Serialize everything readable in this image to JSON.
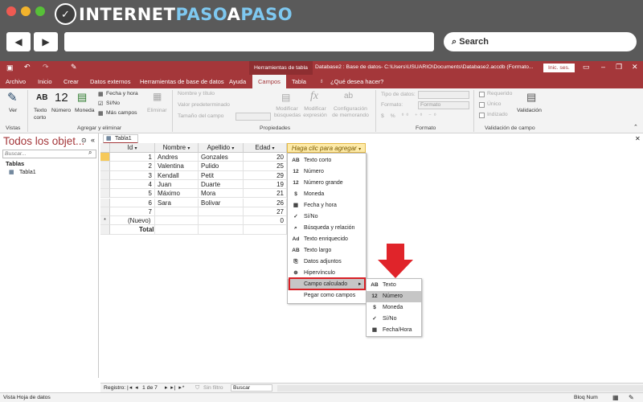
{
  "brand": {
    "logo_part1": "INTERNET",
    "logo_part2": "PASO",
    "logo_part3": "A",
    "logo_part4": "PASO",
    "accent": "#7ec8f0"
  },
  "browser": {
    "search_label": "Search",
    "back": "◀",
    "forward": "▶"
  },
  "title_bar": {
    "contextual": "Herramientas de tabla",
    "title": "Database2 : Base de datos- C:\\Users\\USUARIO\\Documents\\Database2.accdb (Formato...",
    "signin": "Inic. ses.",
    "color": "#a4373a"
  },
  "ribbon_tabs": [
    "Archivo",
    "Inicio",
    "Crear",
    "Datos externos",
    "Herramientas de base de datos",
    "Ayuda",
    "Campos",
    "Tabla"
  ],
  "tell_me": "¿Qué desea hacer?",
  "ribbon": {
    "ver": "Ver",
    "vistas": "Vistas",
    "texto_corto": "Texto corto",
    "numero": "Número",
    "moneda": "Moneda",
    "fecha_hora": "Fecha y hora",
    "si_no": "Sí/No",
    "mas_campos": "Más campos",
    "eliminar": "Eliminar",
    "agregar_eliminar": "Agregar y eliminar",
    "nombre_titulo": "Nombre y título",
    "valor_pred": "Valor predeterminado",
    "tamano": "Tamaño del campo",
    "mod_busquedas": "Modificar búsquedas",
    "mod_expresion": "Modificar expresión",
    "config_memo": "Configuración de memorando",
    "propiedades": "Propiedades",
    "tipo_datos": "Tipo de datos:",
    "formato_lbl": "Formato:",
    "formato_val": "Formato",
    "formato_grp": "Formato",
    "requerido": "Requerido",
    "unico": "Único",
    "indizado": "Indizado",
    "validacion": "Validación",
    "validacion_grp": "Validación de campo"
  },
  "nav": {
    "title": "Todos los objet...",
    "search_placeholder": "Buscar...",
    "section": "Tablas",
    "item": "Tabla1"
  },
  "doc_tab": "Tabla1",
  "table": {
    "columns": [
      "Id",
      "Nombre",
      "Apellido",
      "Edad",
      "Haga clic para agregar"
    ],
    "rows": [
      [
        "1",
        "Andres",
        "Gonzales",
        "20"
      ],
      [
        "2",
        "Valentina",
        "Pulido",
        "25"
      ],
      [
        "3",
        "Kendall",
        "Petit",
        "29"
      ],
      [
        "4",
        "Juan",
        "Duarte",
        "19"
      ],
      [
        "5",
        "Máximo",
        "Mora",
        "21"
      ],
      [
        "6",
        "Sara",
        "Bolivar",
        "26"
      ],
      [
        "7",
        "",
        "",
        "27"
      ]
    ],
    "new_row": [
      "(Nuevo)",
      "",
      "",
      "0"
    ],
    "total_label": "Total"
  },
  "menu": [
    {
      "icon": "AB",
      "label": "Texto corto"
    },
    {
      "icon": "12",
      "label": "Número"
    },
    {
      "icon": "12",
      "label": "Número grande"
    },
    {
      "icon": "$",
      "label": "Moneda"
    },
    {
      "icon": "▦",
      "label": "Fecha y hora"
    },
    {
      "icon": "✓",
      "label": "Sí/No"
    },
    {
      "icon": "⌕",
      "label": "Búsqueda y relación"
    },
    {
      "icon": "Ad",
      "label": "Texto enriquecido"
    },
    {
      "icon": "AB",
      "label": "Texto largo"
    },
    {
      "icon": "⎘",
      "label": "Datos adjuntos"
    },
    {
      "icon": "⊕",
      "label": "Hipervínculo"
    },
    {
      "icon": "",
      "label": "Campo calculado"
    },
    {
      "icon": "",
      "label": "Pegar como campos"
    }
  ],
  "submenu": [
    {
      "icon": "AB",
      "label": "Texto"
    },
    {
      "icon": "12",
      "label": "Número"
    },
    {
      "icon": "$",
      "label": "Moneda"
    },
    {
      "icon": "✓",
      "label": "Sí/No"
    },
    {
      "icon": "▦",
      "label": "Fecha/Hora"
    }
  ],
  "record_bar": {
    "label": "Registro:",
    "position": "1 de 7",
    "filter": "Sin filtro",
    "search": "Buscar"
  },
  "status": {
    "left": "Vista Hoja de datos",
    "right": "Bloq Num"
  }
}
